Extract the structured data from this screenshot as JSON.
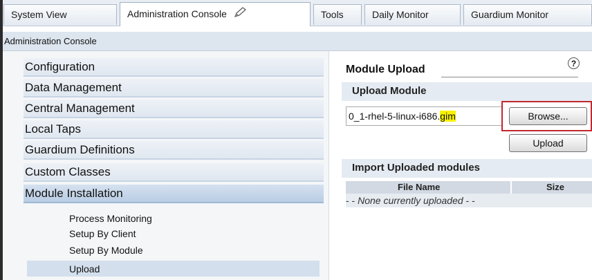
{
  "tabs": [
    {
      "label": "System View"
    },
    {
      "label": "Administration Console",
      "active": true
    },
    {
      "label": "Tools"
    },
    {
      "label": "Daily Monitor"
    },
    {
      "label": "Guardium Monitor"
    }
  ],
  "breadcrumb": "Administration Console",
  "nav": {
    "items": [
      {
        "label": "Configuration"
      },
      {
        "label": "Data Management"
      },
      {
        "label": "Central Management"
      },
      {
        "label": "Local Taps"
      },
      {
        "label": "Guardium Definitions"
      },
      {
        "label": "Custom Classes"
      },
      {
        "label": "Module Installation",
        "selected": true
      }
    ],
    "sub_items": [
      {
        "label": "Process Monitoring"
      },
      {
        "label": "Setup By Client"
      },
      {
        "label": "Setup By Module"
      },
      {
        "label": "Upload",
        "selected": true
      }
    ]
  },
  "module_upload": {
    "title": "Module Upload",
    "help_symbol": "?",
    "upload_section": {
      "title": "Upload Module",
      "file_value_prefix": "0_1-rhel-5-linux-i686.",
      "file_value_highlight": "gim",
      "browse_label": "Browse...",
      "upload_label": "Upload"
    },
    "import_section": {
      "title": "Import Uploaded modules",
      "columns": [
        "File Name",
        "Size"
      ],
      "empty_text_dashes_left": "- -",
      "empty_text": "None currently uploaded",
      "empty_text_dashes_right": "- -"
    }
  },
  "colors": {
    "highlight": "#f7f200",
    "focus_outline": "#c0272d",
    "nav_background": "#dfe7f0"
  },
  "icons": [
    "pencil-icon",
    "help-icon"
  ]
}
